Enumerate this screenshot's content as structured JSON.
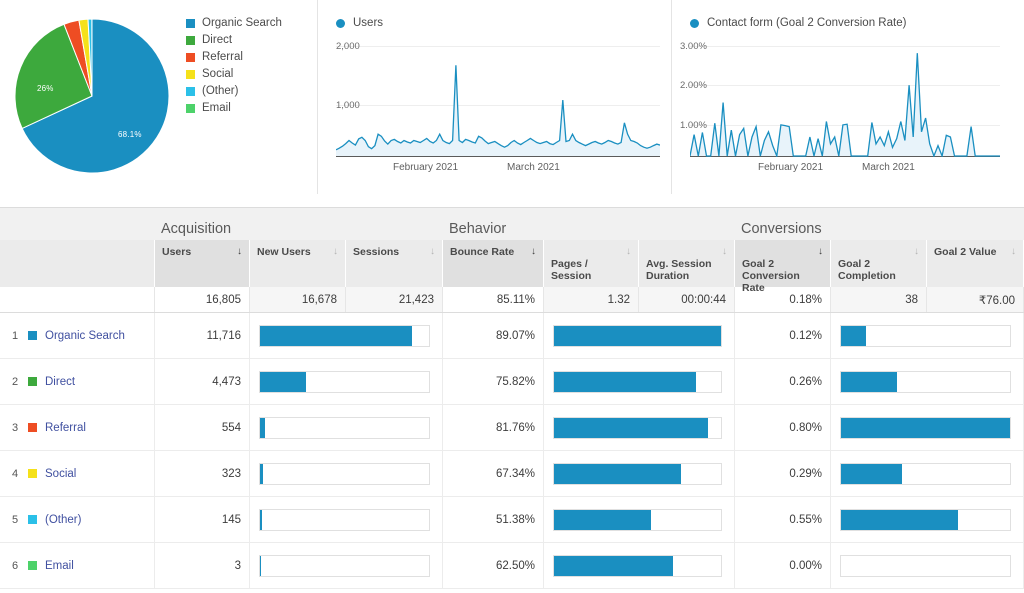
{
  "colors": {
    "accent": "#1a8fc1",
    "organic_search": "#1a8fc1",
    "direct": "#3da93d",
    "referral": "#ee4d23",
    "social": "#f5e11a",
    "other": "#2bc0e8",
    "email": "#4dd26a",
    "link": "#4050a0"
  },
  "pie_card": {
    "legend": [
      {
        "label": "Organic Search",
        "color": "#1a8fc1"
      },
      {
        "label": "Direct",
        "color": "#3da93d"
      },
      {
        "label": "Referral",
        "color": "#ee4d23"
      },
      {
        "label": "Social",
        "color": "#f5e11a"
      },
      {
        "label": "(Other)",
        "color": "#2bc0e8"
      },
      {
        "label": "Email",
        "color": "#4dd26a"
      }
    ],
    "slice_label_major": "68.1%",
    "slice_label_minor": "26%"
  },
  "users_card": {
    "legend_label": "Users",
    "yticks": [
      "2,000",
      "1,000"
    ],
    "xticks": [
      "February 2021",
      "March 2021"
    ]
  },
  "goal_card": {
    "legend_label": "Contact form (Goal 2 Conversion Rate)",
    "yticks": [
      "3.00%",
      "2.00%",
      "1.00%"
    ],
    "xticks": [
      "February 2021",
      "March 2021"
    ]
  },
  "chart_data": [
    {
      "type": "pie",
      "title": "",
      "labels": [
        "Organic Search",
        "Direct",
        "Referral",
        "Social",
        "(Other)",
        "Email"
      ],
      "values": [
        68.1,
        26,
        3.2,
        1.9,
        0.8,
        0.02
      ],
      "value_labels": [
        "68.1%",
        "26%",
        "",
        "",
        "",
        ""
      ],
      "colors": [
        "#1a8fc1",
        "#3da93d",
        "#ee4d23",
        "#f5e11a",
        "#2bc0e8",
        "#4dd26a"
      ],
      "legend_position": "right"
    },
    {
      "type": "area",
      "title": "Users",
      "xlabel": "",
      "ylabel": "",
      "ylim": [
        0,
        2200
      ],
      "yticks": [
        1000,
        2000
      ],
      "ytick_labels": [
        "1,000",
        "2,000"
      ],
      "xtick_labels": [
        "February 2021",
        "March 2021"
      ],
      "xtick_positions": [
        0.33,
        0.62
      ],
      "grid": true,
      "series": [
        {
          "name": "Users",
          "color": "#1a8fc1",
          "values": [
            120,
            150,
            190,
            240,
            300,
            250,
            210,
            330,
            360,
            300,
            180,
            140,
            200,
            420,
            380,
            290,
            230,
            300,
            320,
            280,
            250,
            300,
            270,
            250,
            300,
            280,
            260,
            300,
            340,
            280,
            250,
            300,
            420,
            300,
            260,
            240,
            300,
            1750,
            300,
            260,
            320,
            300,
            270,
            250,
            380,
            350,
            290,
            240,
            260,
            280,
            240,
            200,
            170,
            200,
            260,
            300,
            250,
            220,
            260,
            300,
            340,
            300,
            260,
            240,
            260,
            280,
            240,
            220,
            260,
            300,
            1080,
            280,
            300,
            420,
            300,
            260,
            230,
            200,
            230,
            260,
            280,
            250,
            230,
            260,
            300,
            280,
            250,
            230,
            260,
            640,
            420,
            300,
            280,
            250,
            200,
            170,
            150,
            170,
            200,
            230,
            210
          ]
        }
      ]
    },
    {
      "type": "area",
      "title": "Contact form (Goal 2 Conversion Rate)",
      "xlabel": "",
      "ylabel": "",
      "ylim": [
        0,
        3.3
      ],
      "yticks": [
        1.0,
        2.0,
        3.0
      ],
      "ytick_labels": [
        "1.00%",
        "2.00%",
        "3.00%"
      ],
      "xtick_labels": [
        "February 2021",
        "March 2021"
      ],
      "xtick_positions": [
        0.3,
        0.62
      ],
      "grid": true,
      "series": [
        {
          "name": "Contact form (Goal 2 Conversion Rate)",
          "color": "#1a8fc1",
          "values": [
            0,
            0.62,
            0,
            0.68,
            0,
            0,
            0.95,
            0,
            1.55,
            0,
            0.75,
            0,
            0.62,
            0.8,
            0,
            0.55,
            0.85,
            0,
            0.45,
            0.7,
            0.3,
            0,
            0.9,
            0.88,
            0.85,
            0,
            0,
            0,
            0,
            0.55,
            0,
            0.5,
            0,
            1.0,
            0.35,
            0.55,
            0,
            0.9,
            0.92,
            0,
            0,
            0,
            0,
            0,
            0.97,
            0.35,
            0.55,
            0.3,
            0.7,
            0.25,
            0.5,
            1.0,
            0.45,
            2.05,
            0.55,
            2.98,
            0.7,
            1.1,
            0.35,
            0,
            0.3,
            0,
            0.6,
            0.55,
            0,
            0,
            0,
            0,
            0.85,
            0,
            0,
            0,
            0,
            0,
            0,
            0
          ]
        }
      ]
    }
  ],
  "table": {
    "groups": [
      {
        "label": "Acquisition"
      },
      {
        "label": "Behavior"
      },
      {
        "label": "Conversions"
      }
    ],
    "columns": [
      {
        "key": "users",
        "label": "Users",
        "sorted": true,
        "sort_icon": "↓"
      },
      {
        "key": "new_users",
        "label": "New Users",
        "sorted": false,
        "sort_icon": "↓"
      },
      {
        "key": "sessions",
        "label": "Sessions",
        "sorted": false,
        "sort_icon": "↓"
      },
      {
        "key": "bounce_rate",
        "label": "Bounce Rate",
        "sorted": true,
        "sort_icon": "↓"
      },
      {
        "key": "pages_session",
        "label": "Pages /\nSession",
        "sorted": false,
        "sort_icon": "↓"
      },
      {
        "key": "avg_duration",
        "label": "Avg. Session\nDuration",
        "sorted": false,
        "sort_icon": "↓"
      },
      {
        "key": "goal2_cr",
        "label": "Goal 2\nConversion\nRate",
        "sorted": true,
        "sort_icon": "↓"
      },
      {
        "key": "goal2_completion",
        "label": "Goal 2\nCompletion",
        "sorted": false,
        "sort_icon": "↓"
      },
      {
        "key": "goal2_value",
        "label": "Goal 2 Value",
        "sorted": false,
        "sort_icon": "↓"
      }
    ],
    "totals": {
      "users": "16,805",
      "new_users": "16,678",
      "sessions": "21,423",
      "bounce_rate": "85.11%",
      "pages_session": "1.32",
      "avg_duration": "00:00:44",
      "goal2_cr": "0.18%",
      "goal2_completion": "38",
      "goal2_value": "₹76.00"
    },
    "rows": [
      {
        "rank": "1",
        "channel": "Organic Search",
        "color": "#1a8fc1",
        "users": "11,716",
        "users_bar": 90,
        "bounce_rate": "89.07%",
        "bounce_bar": 100,
        "goal2_cr": "0.12%",
        "goal2_bar": 15
      },
      {
        "rank": "2",
        "channel": "Direct",
        "color": "#3da93d",
        "users": "4,473",
        "users_bar": 27,
        "bounce_rate": "75.82%",
        "bounce_bar": 85,
        "goal2_cr": "0.26%",
        "goal2_bar": 33
      },
      {
        "rank": "3",
        "channel": "Referral",
        "color": "#ee4d23",
        "users": "554",
        "users_bar": 3,
        "bounce_rate": "81.76%",
        "bounce_bar": 92,
        "goal2_cr": "0.80%",
        "goal2_bar": 100
      },
      {
        "rank": "4",
        "channel": "Social",
        "color": "#f5e11a",
        "users": "323",
        "users_bar": 2,
        "bounce_rate": "67.34%",
        "bounce_bar": 76,
        "goal2_cr": "0.29%",
        "goal2_bar": 36
      },
      {
        "rank": "5",
        "channel": "(Other)",
        "color": "#2bc0e8",
        "users": "145",
        "users_bar": 1.2,
        "bounce_rate": "51.38%",
        "bounce_bar": 58,
        "goal2_cr": "0.55%",
        "goal2_bar": 69
      },
      {
        "rank": "6",
        "channel": "Email",
        "color": "#4dd26a",
        "users": "3",
        "users_bar": 0.4,
        "bounce_rate": "62.50%",
        "bounce_bar": 71,
        "goal2_cr": "0.00%",
        "goal2_bar": 0
      }
    ]
  }
}
